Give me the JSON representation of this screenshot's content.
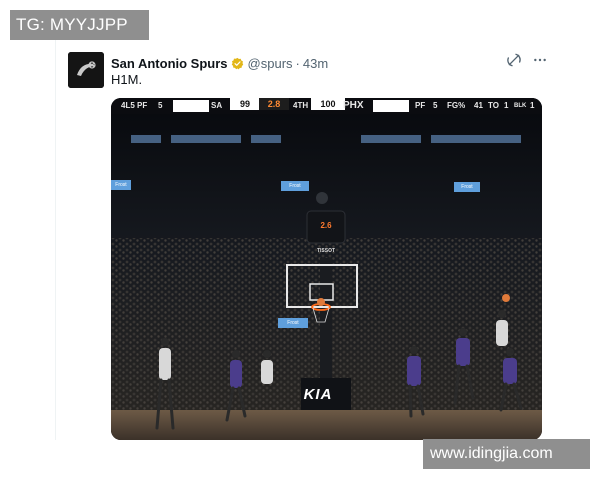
{
  "watermarks": {
    "top_left": "TG: MYYJJPP",
    "bottom_right": "www.idingjia.com"
  },
  "tweet": {
    "author_name": "San Antonio Spurs",
    "handle": "@spurs",
    "separator": "·",
    "time": "43m",
    "text": "H1M.",
    "verified_color": "#e2b719",
    "icons": {
      "avatar": "spurs-logo-icon",
      "verified": "verified-badge-icon",
      "grok": "grok-icon",
      "more": "more-icon"
    }
  },
  "media": {
    "scoreboard": {
      "away_stat": "4L5 PF",
      "away_stat_val": "5",
      "home_abbr": "SA",
      "home_score": "99",
      "clock": "2.8",
      "quarter": "4TH",
      "away_score": "100",
      "away_abbr": "PHX",
      "right_pf": "PF",
      "right_pf_val": "5",
      "right_fg": "FG%",
      "right_fg_val": "41",
      "right_to": "TO",
      "right_to_val": "1",
      "right_blk": "BLK",
      "right_blk_val": "1"
    },
    "shot_clock": "2.6",
    "shot_clock_sponsor": "TISSOT",
    "court_sponsor": "KIA",
    "ad_signs": [
      "Frost",
      "Frost",
      "Frost",
      "Frost"
    ]
  }
}
